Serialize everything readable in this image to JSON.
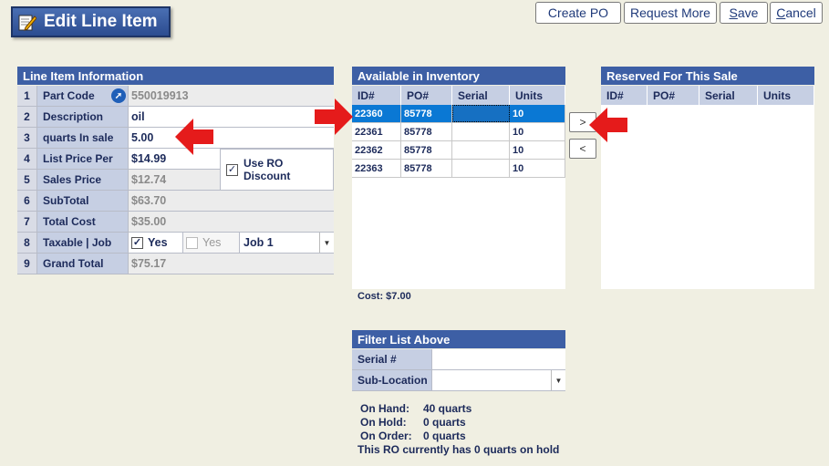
{
  "window": {
    "title": "Edit Line Item"
  },
  "toolbar": {
    "create_po": "Create PO",
    "request_more": "Request More",
    "save_u": "S",
    "save_rest": "ave",
    "cancel_u": "C",
    "cancel_rest": "ancel"
  },
  "line_item": {
    "header": "Line Item Information",
    "rows": [
      {
        "num": "1",
        "label": "Part Code",
        "value": "550019913"
      },
      {
        "num": "2",
        "label": "Description",
        "value": "oil"
      },
      {
        "num": "3",
        "label": "quarts In sale",
        "value": "5.00"
      },
      {
        "num": "4",
        "label": "List Price Per",
        "value": "$14.99"
      },
      {
        "num": "5",
        "label": "Sales Price",
        "value": "$12.74"
      },
      {
        "num": "6",
        "label": "SubTotal",
        "value": "$63.70"
      },
      {
        "num": "7",
        "label": "Total Cost",
        "value": "$35.00"
      },
      {
        "num": "8",
        "label": "Taxable | Job",
        "value": ""
      },
      {
        "num": "9",
        "label": "Grand Total",
        "value": "$75.17"
      }
    ],
    "use_ro_discount": "Use RO Discount",
    "use_ro_line1": "Use RO",
    "use_ro_line2": "Discount",
    "taxable_yes": "Yes",
    "taxable_yes2": "Yes",
    "job": "Job 1"
  },
  "inventory": {
    "header": "Available in Inventory",
    "columns": [
      "ID#",
      "PO#",
      "Serial",
      "Units"
    ],
    "rows": [
      {
        "id": "22360",
        "po": "85778",
        "serial": "",
        "units": "10"
      },
      {
        "id": "22361",
        "po": "85778",
        "serial": "",
        "units": "10"
      },
      {
        "id": "22362",
        "po": "85778",
        "serial": "",
        "units": "10"
      },
      {
        "id": "22363",
        "po": "85778",
        "serial": "",
        "units": "10"
      }
    ],
    "cost": "Cost:  $7.00"
  },
  "transfer": {
    "add": ">",
    "remove": "<"
  },
  "reserved": {
    "header": "Reserved For This Sale",
    "columns": [
      "ID#",
      "PO#",
      "Serial",
      "Units"
    ]
  },
  "filter": {
    "header": "Filter List Above",
    "serial_label": "Serial #",
    "sublocation_label": "Sub-Location"
  },
  "stock": {
    "on_hand_label": "On Hand:",
    "on_hand": "40 quarts",
    "on_hold_label": "On Hold:",
    "on_hold": "0 quarts",
    "on_order_label": "On Order:",
    "on_order": "0 quarts",
    "note": "This RO currently has 0 quarts on hold"
  },
  "colors": {
    "header": "#3d5fa5",
    "selected_row": "#0a78d4",
    "arrow": "#e51b1b"
  }
}
